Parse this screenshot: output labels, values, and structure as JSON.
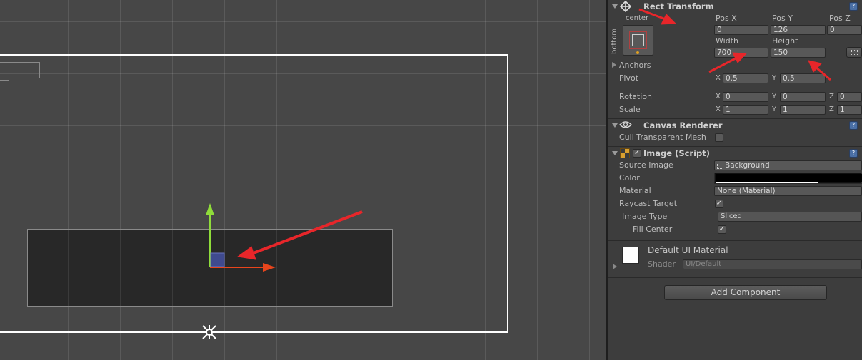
{
  "inspector": {
    "rect_transform": {
      "title": "Rect Transform",
      "anchor_h_label": "center",
      "anchor_v_label": "bottom",
      "pos_x_label": "Pos X",
      "pos_x_value": "0",
      "pos_y_label": "Pos Y",
      "pos_y_value": "126",
      "pos_z_label": "Pos Z",
      "pos_z_value": "0",
      "width_label": "Width",
      "width_value": "700",
      "height_label": "Height",
      "height_value": "150",
      "anchors_label": "Anchors",
      "pivot_label": "Pivot",
      "pivot_x": "0.5",
      "pivot_y": "0.5",
      "rotation_label": "Rotation",
      "rot_x": "0",
      "rot_y": "0",
      "rot_z": "0",
      "scale_label": "Scale",
      "scale_x": "1",
      "scale_y": "1",
      "scale_z": "1",
      "axis_x": "X",
      "axis_y": "Y",
      "axis_z": "Z"
    },
    "canvas_renderer": {
      "title": "Canvas Renderer",
      "cull_label": "Cull Transparent Mesh",
      "cull_checked": false
    },
    "image_script": {
      "title": "Image (Script)",
      "enabled": true,
      "source_image_label": "Source Image",
      "source_image_value": "Background",
      "color_label": "Color",
      "color_value": "#ffffff",
      "material_label": "Material",
      "material_value": "None (Material)",
      "raycast_label": "Raycast Target",
      "raycast_checked": true,
      "image_type_label": "Image Type",
      "image_type_value": "Sliced",
      "fill_center_label": "Fill Center",
      "fill_center_checked": true
    },
    "material": {
      "name": "Default UI Material",
      "shader_label": "Shader",
      "shader_value": "UI/Default"
    },
    "add_component_label": "Add Component"
  },
  "colors": {
    "scene_bg": "#474747",
    "inspector_bg": "#3d3d3d",
    "annotation_arrow": "#e8262a",
    "gizmo_y": "#8fdc3a",
    "gizmo_x": "#e8451c",
    "gizmo_handle": "#3f4a8f"
  },
  "icons": {
    "rect_transform": "move-arrows-icon",
    "canvas_renderer": "eye-icon",
    "image_script": "image-component-icon",
    "help": "help-book-icon",
    "pivot": "pivot-star-icon"
  }
}
